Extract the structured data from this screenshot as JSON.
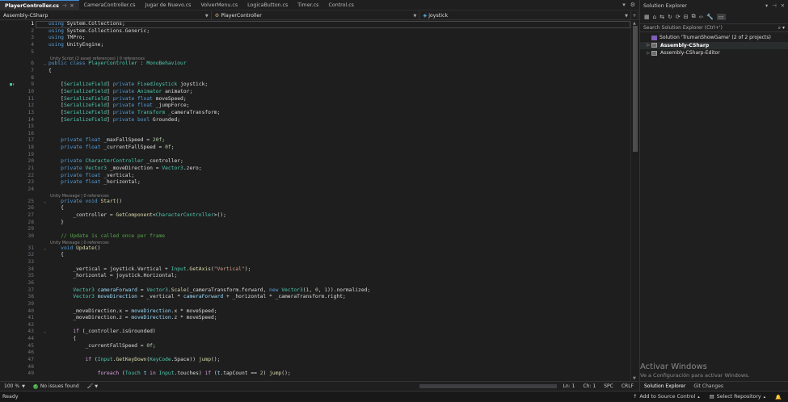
{
  "tabs": [
    {
      "label": "PlayerController.cs",
      "active": true
    },
    {
      "label": "CameraController.cs"
    },
    {
      "label": "Jugar de Nuevo.cs"
    },
    {
      "label": "VolverMenu.cs"
    },
    {
      "label": "LogicaButton.cs"
    },
    {
      "label": "Timer.cs"
    },
    {
      "label": "Control.cs"
    }
  ],
  "nav": {
    "project": "Assembly-CSharp",
    "class": "PlayerController",
    "member": "joystick"
  },
  "code_lines": [
    {
      "n": "1",
      "h": "<span class=\"kw\">using</span> System.Collections;"
    },
    {
      "n": "2",
      "h": "<span class=\"kw\">using</span> System.Collections.Generic;"
    },
    {
      "n": "3",
      "h": "<span class=\"kw\">using</span> TMPro;"
    },
    {
      "n": "4",
      "h": "<span class=\"kw\">using</span> UnityEngine;"
    },
    {
      "n": "5",
      "h": ""
    },
    {
      "n": "6",
      "h": "<span class=\"kw\">public class</span> <span class=\"ty\">PlayerController</span> : <span class=\"ty\">MonoBehaviour</span>",
      "lens": "Unity Script (2 asset references) | 0 references"
    },
    {
      "n": "7",
      "h": "{"
    },
    {
      "n": "8",
      "h": ""
    },
    {
      "n": "9",
      "h": "    [<span class=\"ty\">SerializeField</span>] <span class=\"kw\">private</span> <span class=\"ty\">FixedJoystick</span> joystick;"
    },
    {
      "n": "10",
      "h": "    [<span class=\"ty\">SerializeField</span>] <span class=\"kw\">private</span> <span class=\"ty\">Animator</span> animator;"
    },
    {
      "n": "11",
      "h": "    [<span class=\"ty\">SerializeField</span>] <span class=\"kw\">private float</span> moveSpeed;"
    },
    {
      "n": "12",
      "h": "    [<span class=\"ty\">SerializeField</span>] <span class=\"kw\">private float</span> _jumpForce;"
    },
    {
      "n": "13",
      "h": "    [<span class=\"ty\">SerializeField</span>] <span class=\"kw\">private</span> <span class=\"ty\">Transform</span> _cameraTransform;"
    },
    {
      "n": "14",
      "h": "    [<span class=\"ty\">SerializeField</span>] <span class=\"kw\">private bool</span> Grounded;"
    },
    {
      "n": "15",
      "h": ""
    },
    {
      "n": "16",
      "h": ""
    },
    {
      "n": "17",
      "h": "    <span class=\"kw\">private float</span> _maxFallSpeed = <span class=\"num\">20f</span>;"
    },
    {
      "n": "18",
      "h": "    <span class=\"kw\">private float</span> _currentFallSpeed = <span class=\"num\">0f</span>;"
    },
    {
      "n": "19",
      "h": ""
    },
    {
      "n": "20",
      "h": "    <span class=\"kw\">private</span> <span class=\"ty\">CharacterController</span> _controller;"
    },
    {
      "n": "21",
      "h": "    <span class=\"kw\">private</span> <span class=\"ty\">Vector3</span> _moveDirection = <span class=\"ty\">Vector3</span>.zero;"
    },
    {
      "n": "22",
      "h": "    <span class=\"kw\">private float</span> _vertical;"
    },
    {
      "n": "23",
      "h": "    <span class=\"kw\">private float</span> _horizontal;"
    },
    {
      "n": "24",
      "h": ""
    },
    {
      "n": "25",
      "h": "    <span class=\"kw\">private void</span> <span class=\"md\">Start</span>()",
      "lens": "Unity Message | 0 references"
    },
    {
      "n": "26",
      "h": "    {"
    },
    {
      "n": "27",
      "h": "        _controller = <span class=\"md\">GetComponent</span>&lt;<span class=\"ty\">CharacterController</span>&gt;();"
    },
    {
      "n": "28",
      "h": "    }"
    },
    {
      "n": "29",
      "h": ""
    },
    {
      "n": "30",
      "h": "    <span class=\"cm\">// Update is called once per frame</span>"
    },
    {
      "n": "31",
      "h": "    <span class=\"kw\">void</span> <span class=\"md\">Update</span>()",
      "lens": "Unity Message | 0 references"
    },
    {
      "n": "32",
      "h": "    {"
    },
    {
      "n": "33",
      "h": ""
    },
    {
      "n": "34",
      "h": "        _vertical = joystick.Vertical + <span class=\"ty\">Input</span>.<span class=\"md\">GetAxis</span>(<span class=\"str\">\"Vertical\"</span>);"
    },
    {
      "n": "35",
      "h": "        _horizontal = joystick.Horizontal;"
    },
    {
      "n": "36",
      "h": ""
    },
    {
      "n": "37",
      "h": "        <span class=\"ty\">Vector3</span> <span class=\"fld\">cameraForward</span> = <span class=\"ty\">Vector3</span>.<span class=\"md\">Scale</span>(_cameraTransform.forward, <span class=\"kw\">new</span> <span class=\"ty\">Vector3</span>(<span class=\"num\">1</span>, <span class=\"num\">0</span>, <span class=\"num\">1</span>)).normalized;"
    },
    {
      "n": "38",
      "h": "        <span class=\"ty\">Vector3</span> <span class=\"fld\">moveDirection</span> = _vertical * <span class=\"fld\">cameraForward</span> + _horizontal * _cameraTransform.right;"
    },
    {
      "n": "39",
      "h": ""
    },
    {
      "n": "40",
      "h": "        _moveDirection.x = <span class=\"fld\">moveDirection</span>.x * moveSpeed;"
    },
    {
      "n": "41",
      "h": "        _moveDirection.z = <span class=\"fld\">moveDirection</span>.z * moveSpeed;"
    },
    {
      "n": "42",
      "h": ""
    },
    {
      "n": "43",
      "h": "        <span class=\"ctl\">if</span> (_controller.isGrounded)"
    },
    {
      "n": "44",
      "h": "        {"
    },
    {
      "n": "45",
      "h": "            _currentFallSpeed = <span class=\"num\">0f</span>;"
    },
    {
      "n": "46",
      "h": ""
    },
    {
      "n": "47",
      "h": "            <span class=\"ctl\">if</span> (<span class=\"ty\">Input</span>.<span class=\"md\">GetKeyDown</span>(<span class=\"ty\">KeyCode</span>.Space)) <span class=\"md\">jump</span>();"
    },
    {
      "n": "48",
      "h": ""
    },
    {
      "n": "49",
      "h": "                <span class=\"ctl\">foreach</span> (<span class=\"ty\">Touch</span> <span class=\"fld\">t</span> <span class=\"ctl\">in</span> <span class=\"ty\">Input</span>.touches) <span class=\"ctl\">if</span> (<span class=\"fld\">t</span>.tapCount == <span class=\"num\">2</span>) <span class=\"md\">jump</span>();"
    }
  ],
  "editor_status": {
    "zoom": "100 %",
    "issues": "No issues found",
    "line": "Ln: 1",
    "col": "Ch: 1",
    "whitespace": "SPC",
    "eol": "CRLF"
  },
  "solution_explorer": {
    "title": "Solution Explorer",
    "search_placeholder": "Search Solution Explorer (Ctrl+')",
    "nodes": [
      {
        "label": "Solution 'TrumanShowGame' (2 of 2 projects)",
        "type": "solution"
      },
      {
        "label": "Assembly-CSharp",
        "type": "project",
        "bold": true,
        "selected": true
      },
      {
        "label": "Assembly-CSharp-Editor",
        "type": "project"
      }
    ],
    "tabs": [
      "Solution Explorer",
      "Git Changes"
    ]
  },
  "watermark": {
    "title": "Activar Windows",
    "subtitle": "Ve a Configuración para activar Windows."
  },
  "statusbar": {
    "ready": "Ready",
    "source_control": "Add to Source Control",
    "repository": "Select Repository"
  },
  "colors": {
    "accent": "#3f8ad6",
    "editor_bg": "#1e1e1e",
    "keyword": "#569cd6",
    "type": "#4ec9b0",
    "string": "#d69d85",
    "comment": "#57a64a"
  }
}
